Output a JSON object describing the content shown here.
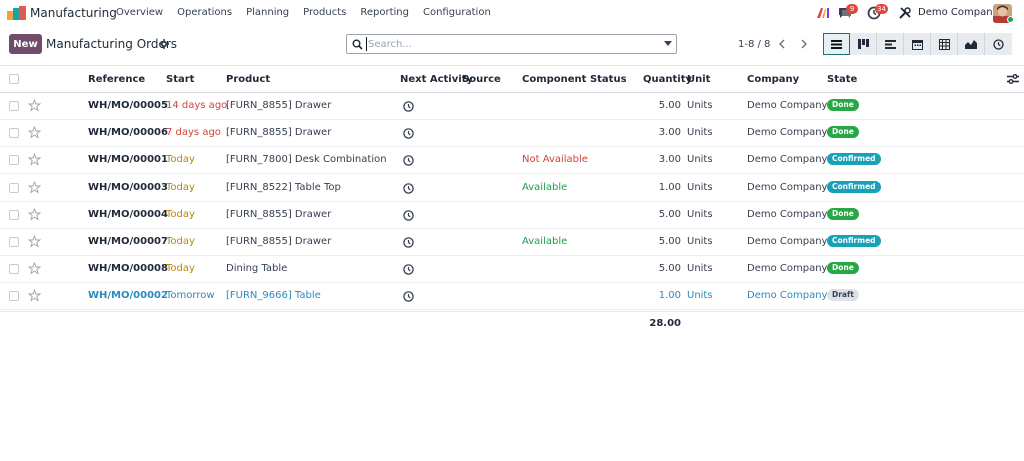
{
  "navbar": {
    "app_name": "Manufacturing",
    "menu": [
      "Overview",
      "Operations",
      "Planning",
      "Products",
      "Reporting",
      "Configuration"
    ],
    "messages_badge": "9",
    "activities_badge": "34",
    "company": "Demo Company"
  },
  "control_panel": {
    "new_label": "New",
    "title": "Manufacturing Orders",
    "search_placeholder": "Search...",
    "pager": "1-8 / 8"
  },
  "table": {
    "headers": {
      "reference": "Reference",
      "start": "Start",
      "product": "Product",
      "next_activity": "Next Activity",
      "source": "Source",
      "component_status": "Component Status",
      "quantity": "Quantity",
      "unit": "Unit",
      "company": "Company",
      "state": "State"
    },
    "rows": [
      {
        "reference": "WH/MO/00005",
        "start": "14 days ago",
        "product": "[FURN_8855] Drawer",
        "component_status": "",
        "quantity": "5.00",
        "unit": "Units",
        "company": "Demo Company",
        "state": "Done"
      },
      {
        "reference": "WH/MO/00006",
        "start": "7 days ago",
        "product": "[FURN_8855] Drawer",
        "component_status": "",
        "quantity": "3.00",
        "unit": "Units",
        "company": "Demo Company",
        "state": "Done"
      },
      {
        "reference": "WH/MO/00001",
        "start": "Today",
        "product": "[FURN_7800] Desk Combination",
        "component_status": "Not Available",
        "quantity": "3.00",
        "unit": "Units",
        "company": "Demo Company",
        "state": "Confirmed"
      },
      {
        "reference": "WH/MO/00003",
        "start": "Today",
        "product": "[FURN_8522] Table Top",
        "component_status": "Available",
        "quantity": "1.00",
        "unit": "Units",
        "company": "Demo Company",
        "state": "Confirmed"
      },
      {
        "reference": "WH/MO/00004",
        "start": "Today",
        "product": "[FURN_8855] Drawer",
        "component_status": "",
        "quantity": "5.00",
        "unit": "Units",
        "company": "Demo Company",
        "state": "Done"
      },
      {
        "reference": "WH/MO/00007",
        "start": "Today",
        "product": "[FURN_8855] Drawer",
        "component_status": "Available",
        "quantity": "5.00",
        "unit": "Units",
        "company": "Demo Company",
        "state": "Confirmed"
      },
      {
        "reference": "WH/MO/00008",
        "start": "Today",
        "product": "Dining Table",
        "component_status": "",
        "quantity": "5.00",
        "unit": "Units",
        "company": "Demo Company",
        "state": "Done"
      },
      {
        "reference": "WH/MO/00002",
        "start": "Tomorrow",
        "product": "[FURN_9666] Table",
        "component_status": "",
        "quantity": "1.00",
        "unit": "Units",
        "company": "Demo Company",
        "state": "Draft"
      }
    ],
    "total_quantity": "28.00"
  },
  "colors": {
    "brand": "#714b67",
    "done": "#28a745",
    "confirmed": "#17a2b8",
    "draft": "#dee2e6",
    "late": "#d0443b",
    "today": "#b8860b",
    "available": "#1f9d4e",
    "draft_row": "#2a8cbd"
  }
}
